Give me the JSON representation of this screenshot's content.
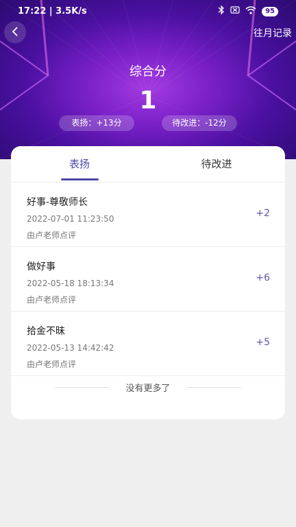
{
  "status": {
    "time": "17:22 | 3.5K/s",
    "battery": "95"
  },
  "header": {
    "history_label": "往月记录",
    "score_title": "综合分",
    "score_value": "1",
    "praise_pill": "表扬：+13分",
    "improve_pill": "待改进：-12分"
  },
  "tabs": [
    {
      "label": "表扬",
      "active": true
    },
    {
      "label": "待改进",
      "active": false
    }
  ],
  "items": [
    {
      "title": "好事-尊敬师长",
      "time": "2022-07-01 11:23:50",
      "reviewer": "由卢老师点评",
      "points": "+2"
    },
    {
      "title": "做好事",
      "time": "2022-05-18 18:13:34",
      "reviewer": "由卢老师点评",
      "points": "+6"
    },
    {
      "title": "拾金不昧",
      "time": "2022-05-13 14:42:42",
      "reviewer": "由卢老师点评",
      "points": "+5"
    }
  ],
  "footer": {
    "no_more": "没有更多了"
  },
  "colors": {
    "accent": "#4e46a8",
    "hero_dark": "#2a0a70",
    "hero_light": "#a33be0"
  },
  "icons": [
    "back-arrow-icon",
    "bluetooth-icon",
    "sim-icon",
    "wifi-icon",
    "battery-icon"
  ]
}
